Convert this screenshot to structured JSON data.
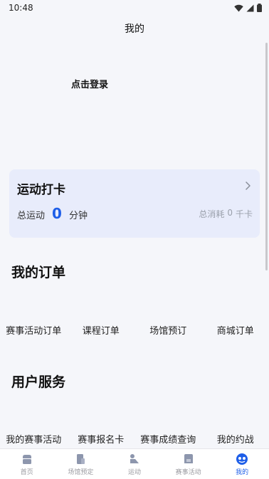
{
  "status_bar": {
    "time": "10:48"
  },
  "header": {
    "title": "我的"
  },
  "profile": {
    "login_label": "点击登录"
  },
  "checkin": {
    "title": "运动打卡",
    "total_label": "总运动",
    "total_value": "0",
    "total_unit": "分钟",
    "consume_label": "总消耗",
    "consume_value": "0",
    "consume_unit": "千卡"
  },
  "orders": {
    "heading": "我的订单",
    "items": [
      "赛事活动订单",
      "课程订单",
      "场馆预订",
      "商城订单"
    ]
  },
  "services": {
    "heading": "用户服务",
    "items": [
      "我的赛事活动",
      "赛事报名卡",
      "赛事成绩查询",
      "我的约战"
    ]
  },
  "tab_bar": {
    "items": [
      {
        "label": "首页",
        "icon": "home-icon"
      },
      {
        "label": "场馆预定",
        "icon": "venue-icon"
      },
      {
        "label": "运动",
        "icon": "sport-icon"
      },
      {
        "label": "赛事活动",
        "icon": "event-icon"
      },
      {
        "label": "我的",
        "icon": "profile-icon"
      }
    ],
    "active_index": 4
  },
  "colors": {
    "accent": "#1e5ee8",
    "card_bg": "#e8ecfb",
    "page_bg": "#f5f6fa"
  }
}
